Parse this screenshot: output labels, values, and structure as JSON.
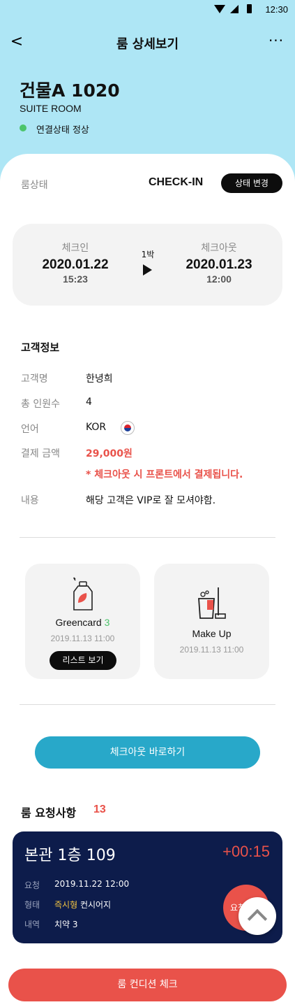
{
  "status_bar": {
    "time": "12:30"
  },
  "nav": {
    "back": "<",
    "title": "룸 상세보기",
    "more": "···"
  },
  "header": {
    "room_title": "건물A 1020",
    "room_type": "SUITE ROOM",
    "connection_status": "연결상태 정상",
    "connection_color": "#4cc46b"
  },
  "room_state": {
    "label": "룸상태",
    "value": "CHECK-IN",
    "change_button": "상태 변경"
  },
  "stay": {
    "checkin_label": "체크인",
    "checkin_date": "2020.01.22",
    "checkin_time": "15:23",
    "nights": "1박",
    "checkout_label": "체크아웃",
    "checkout_date": "2020.01.23",
    "checkout_time": "12:00"
  },
  "customer": {
    "section_title": "고객정보",
    "rows": [
      {
        "label": "고객명",
        "value": "한녕희"
      },
      {
        "label": "총 인원수",
        "value": "4"
      },
      {
        "label": "언어",
        "value": "KOR"
      },
      {
        "label": "결제 금액",
        "value": "29,000원"
      },
      {
        "label": "내용",
        "value": "해당 고객은 VIP로 잘 모셔야함."
      }
    ],
    "payment_note": "* 체크아웃 시 프론트에서 결제됩니다.",
    "language_icon": "korea-flag-icon",
    "highlight_color": "#e9524a"
  },
  "services": [
    {
      "name": "Greencard",
      "count": "3",
      "date": "2019.11.13 11:00",
      "button": "리스트 보기",
      "icon": "greencard-tag-icon"
    },
    {
      "name": "Make Up",
      "date": "2019.11.13 11:00",
      "icon": "cleaning-bucket-icon"
    }
  ],
  "checkout_button": "체크아웃 바로하기",
  "requests": {
    "title": "룸 요청사항",
    "count": "13",
    "card": {
      "room": "본관 1층 109",
      "timer": "+00:15",
      "rows": [
        {
          "label": "요청",
          "value": "2019.11.22 12:00"
        },
        {
          "label": "형태",
          "value_highlight": "즉시형",
          "value": " 컨시어지"
        },
        {
          "label": "내역",
          "value": "치약 3"
        }
      ],
      "bubble": "요청"
    }
  },
  "bottom_button": "룸 컨디션 체크",
  "colors": {
    "header_bg": "#aee6f5",
    "accent_red": "#e9524a",
    "accent_blue": "#28a8c9",
    "navy_card": "#0d1c4b"
  }
}
